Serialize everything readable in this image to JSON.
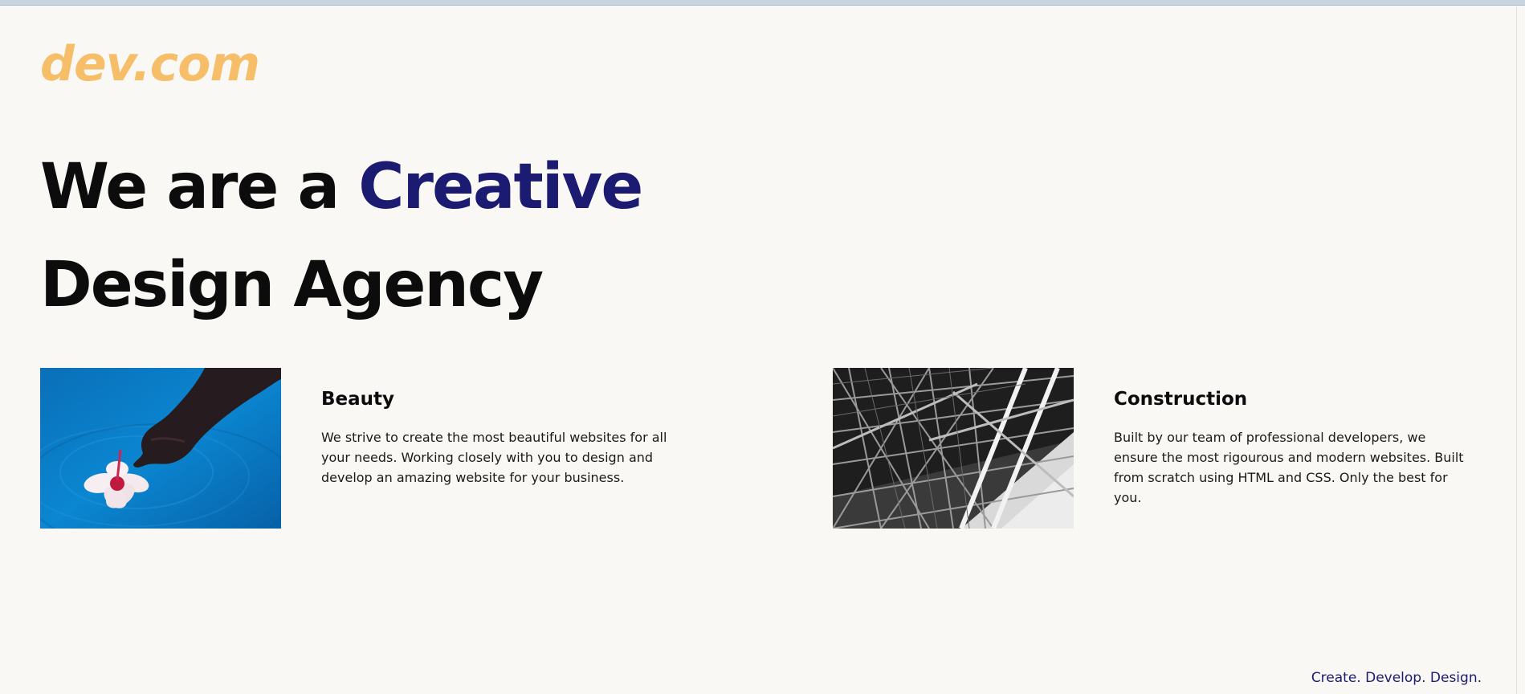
{
  "logo": {
    "text": "dev.com"
  },
  "hero": {
    "prefix": "We are a ",
    "accent": "Creative",
    "suffix": "Design Agency"
  },
  "cards": [
    {
      "title": "Beauty",
      "text": "We strive to create the most beautiful websites for all your needs. Working closely with you to design and develop an amazing website for your business.",
      "image": "hand-touching-flower-on-water-photo"
    },
    {
      "title": "Construction",
      "text": "Built by our team of professional developers, we ensure the most rigourous and modern websites. Built from scratch using HTML and CSS. Only the best for you.",
      "image": "steel-scaffolding-structure-photo"
    }
  ],
  "footer": {
    "tagline": "Create. Develop. Design."
  },
  "colors": {
    "background": "#f9f8f5",
    "logo": "#f7be6a",
    "accent": "#1c1b72",
    "text": "#0c0c0c"
  }
}
